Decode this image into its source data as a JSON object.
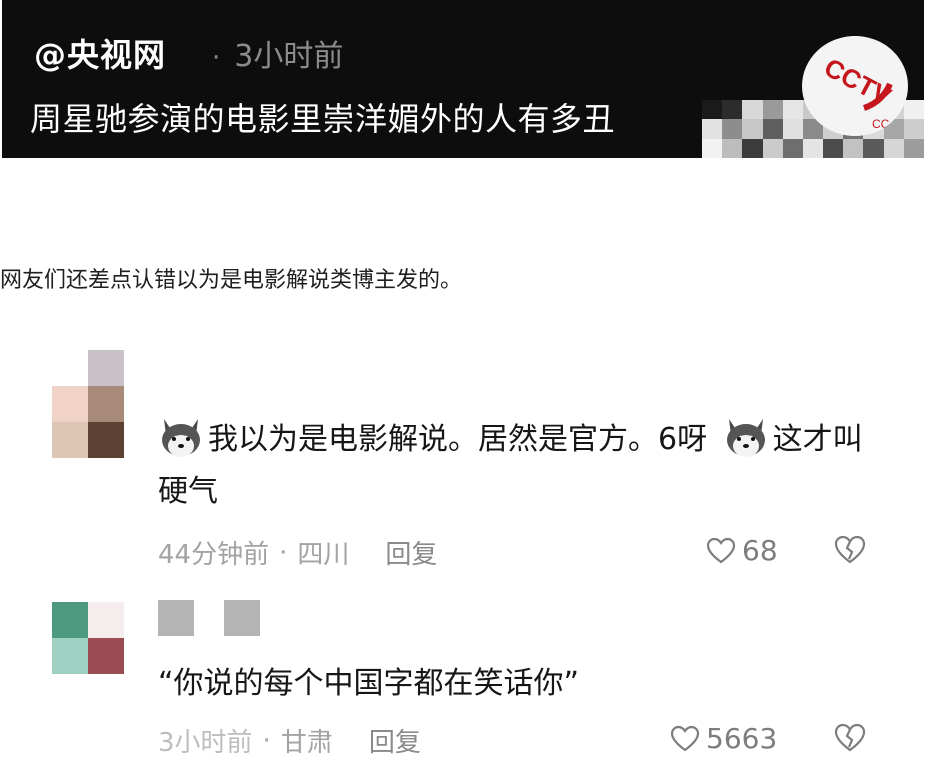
{
  "post": {
    "handle": "@央视网",
    "separator": "·",
    "time": "3小时前",
    "title": "周星驰参演的电影里崇洋媚外的人有多丑",
    "logo_icon": "cctv-logo-icon"
  },
  "caption": "网友们还差点认错以为是电影解说类博主发的。",
  "comments": [
    {
      "text_part1": "我以为是电影解说。居然是官方。6呀",
      "text_part2": "这才叫硬气",
      "emoji_icon": "husky-dog-emoji-icon",
      "time": "44分钟前",
      "separator": "·",
      "location": "四川",
      "reply_label": "回复",
      "likes": "68"
    },
    {
      "text": "“你说的每个中国字都在笑话你”",
      "time": "3小时前",
      "separator": "·",
      "location": "甘肃",
      "reply_label": "回复",
      "likes": "5663"
    }
  ],
  "colors": {
    "header_bg": "#0d0d0d",
    "header_text": "#ffffff",
    "muted_text": "#a3a3a3",
    "cctv_red": "#c4161c"
  }
}
